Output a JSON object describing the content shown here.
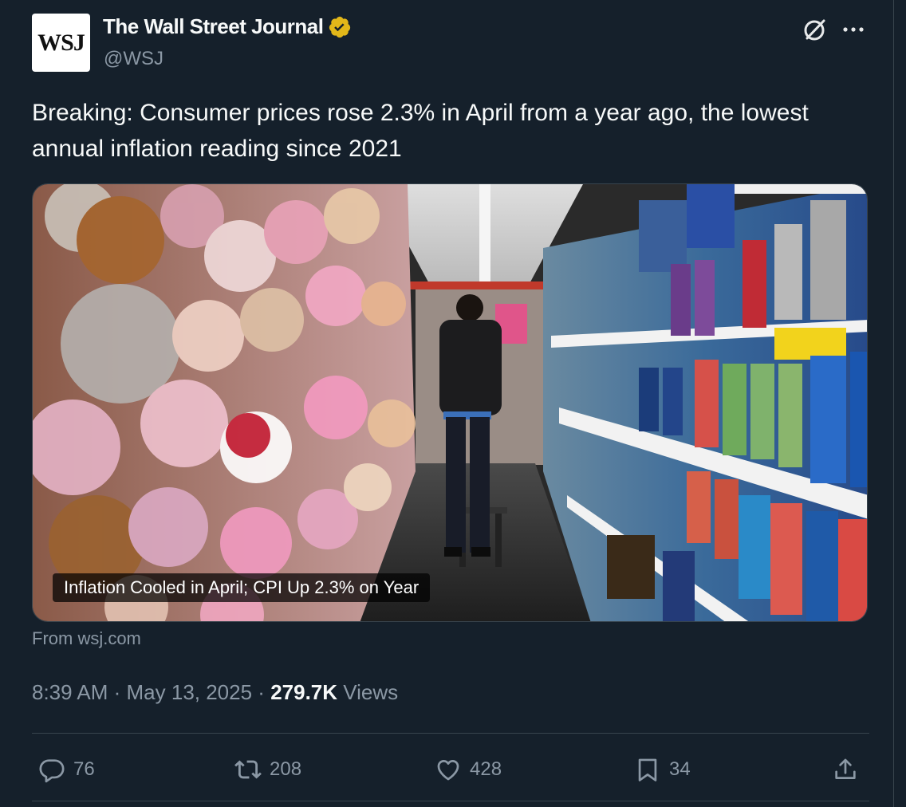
{
  "author": {
    "avatar_text": "WSJ",
    "display_name": "The Wall Street Journal",
    "handle": "@WSJ",
    "verified_color": "#e2b719"
  },
  "tweet": {
    "text": "Breaking: Consumer prices rose 2.3% in April from a year ago, the lowest annual inflation reading since 2021"
  },
  "card": {
    "caption": "Inflation Cooled in April; CPI Up 2.3% on Year",
    "source": "From wsj.com"
  },
  "meta": {
    "time": "8:39 AM",
    "sep1": " · ",
    "date": "May 13, 2025",
    "sep2": " · ",
    "views_count": "279.7K",
    "views_label": " Views"
  },
  "actions": {
    "replies": "76",
    "reposts": "208",
    "likes": "428",
    "bookmarks": "34"
  },
  "icons": [
    "grok-icon",
    "more-icon",
    "verified-badge-icon",
    "reply-icon",
    "repost-icon",
    "like-icon",
    "bookmark-icon",
    "share-icon"
  ],
  "colors": {
    "background": "#15202b",
    "text": "#f7f9f9",
    "secondary": "#8b98a5",
    "border": "#38444d"
  }
}
